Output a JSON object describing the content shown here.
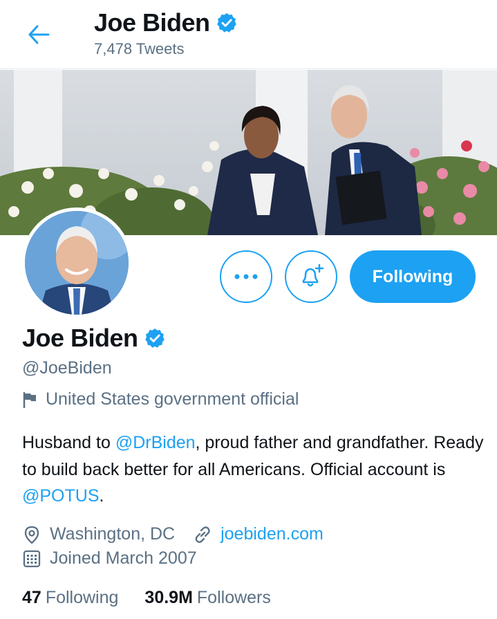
{
  "header": {
    "back_icon": "arrow-left-icon",
    "name": "Joe Biden",
    "verified_icon": "verified-badge-icon",
    "tweet_count": "7,478 Tweets"
  },
  "banner": {
    "alt": "banner-photo"
  },
  "avatar": {
    "alt": "profile-photo"
  },
  "actions": {
    "more_icon": "more-dots-icon",
    "notify_icon": "bell-plus-icon",
    "following_label": "Following"
  },
  "profile": {
    "name": "Joe Biden",
    "handle": "@JoeBiden",
    "affiliation_icon": "flag-icon",
    "affiliation": "United States government official"
  },
  "bio": {
    "part1": "Husband to ",
    "mention1": "@DrBiden",
    "part2": ", proud father and grandfather. Ready to build back better for all Americans. Official account is ",
    "mention2": "@POTUS",
    "part3": "."
  },
  "meta": {
    "location_icon": "location-pin-icon",
    "location": "Washington, DC",
    "link_icon": "link-icon",
    "website": "joebiden.com",
    "calendar_icon": "calendar-icon",
    "joined": "Joined March 2007"
  },
  "stats": {
    "following_count": "47",
    "following_label": "Following",
    "followers_count": "30.9M",
    "followers_label": "Followers"
  },
  "colors": {
    "accent": "#1da1f2",
    "text_primary": "#0f1419",
    "text_secondary": "#5b7083"
  }
}
